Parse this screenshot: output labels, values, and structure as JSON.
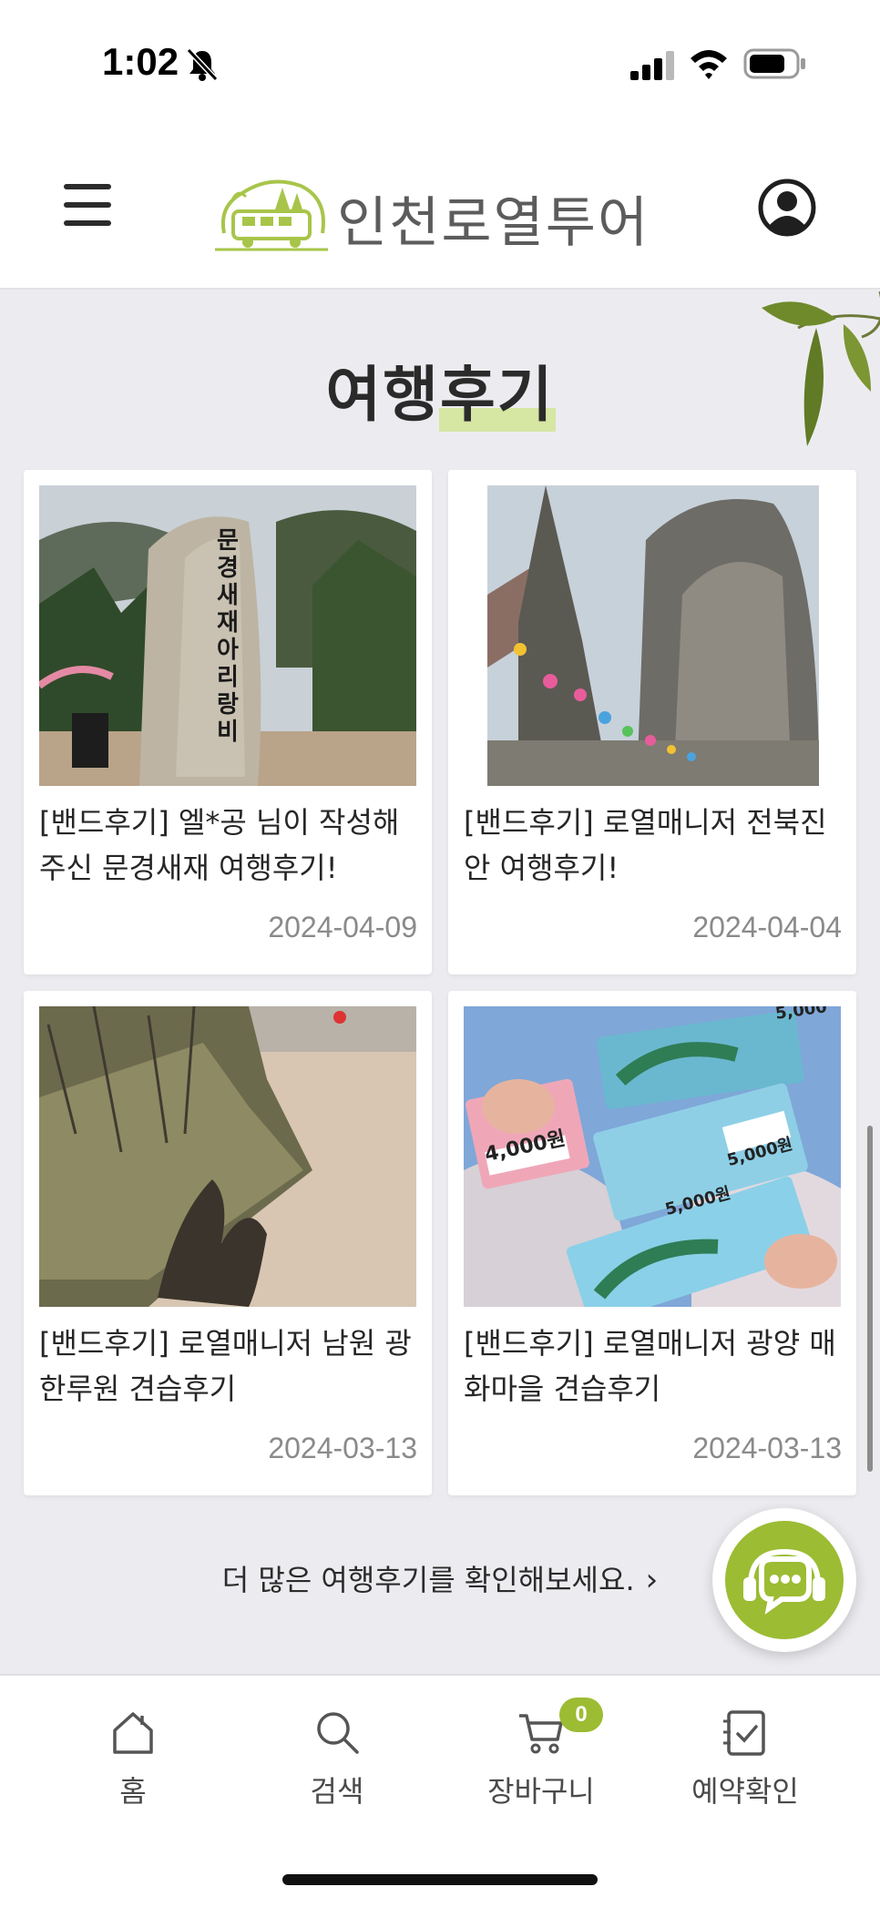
{
  "status_bar": {
    "time": "1:02"
  },
  "header": {
    "logo_text": "인천로열투어"
  },
  "section": {
    "title": "여행후기"
  },
  "reviews": [
    {
      "title": "[밴드후기] 엘*공 님이 작성해 주신 문경새재 여행후기!",
      "date": "2024-04-09",
      "image": "문경새재 아리랑비 stone monument",
      "stone_text": "문경새재아리랑비"
    },
    {
      "title": "[밴드후기] 로열매니저 전북진안 여행후기!",
      "date": "2024-04-04",
      "image": "stone tower and cliff with lanterns"
    },
    {
      "title": "[밴드후기] 로열매니저 남원 광한루원 견습후기",
      "date": "2024-03-13",
      "image": "shadows on path with bushes"
    },
    {
      "title": "[밴드후기] 로열매니저 광양 매화마을 견습후기",
      "date": "2024-03-13",
      "image": "gift vouchers in hands",
      "voucher_amounts": [
        "4,000원",
        "5,000원",
        "5,000원",
        "5,000"
      ]
    }
  ],
  "more_link": {
    "label": "더 많은 여행후기를 확인해보세요."
  },
  "bottom_nav": {
    "items": [
      {
        "label": "홈",
        "icon": "home-icon"
      },
      {
        "label": "검색",
        "icon": "search-icon"
      },
      {
        "label": "장바구니",
        "icon": "cart-icon"
      },
      {
        "label": "예약확인",
        "icon": "reservation-icon"
      }
    ],
    "cart_count": "0"
  },
  "colors": {
    "accent": "#9cbc33",
    "highlight": "#d6e6a3",
    "background": "#ececf0"
  }
}
